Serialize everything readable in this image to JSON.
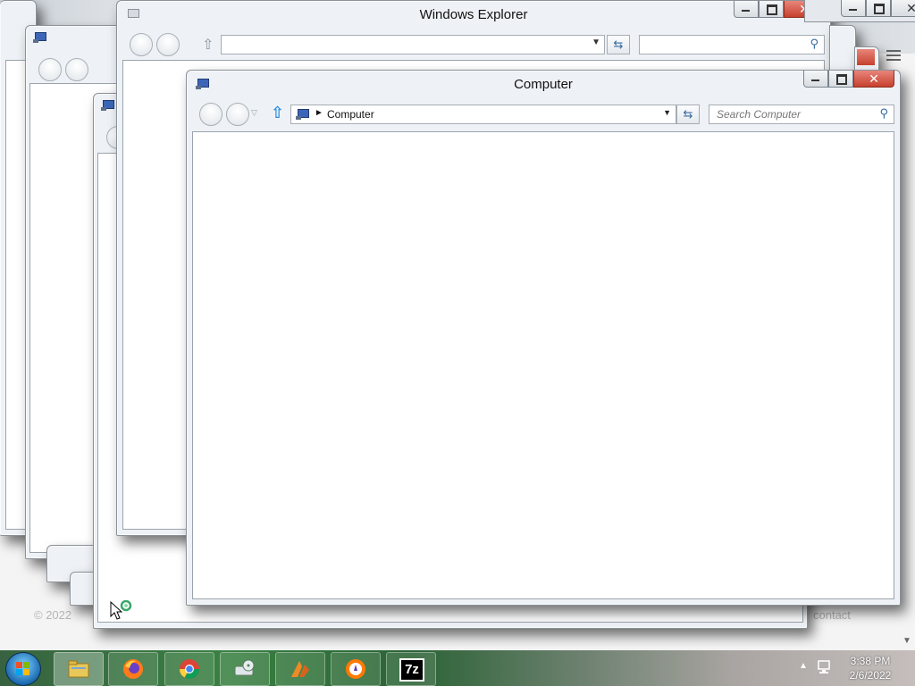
{
  "background_page": {
    "footer_left": "© 2022",
    "footer_right": "contact"
  },
  "windows": {
    "explorer_back": {
      "title": "Windows Explorer"
    },
    "computer": {
      "title": "Computer",
      "address": "Computer",
      "search_placeholder": "Search Computer"
    }
  },
  "taskbar": {
    "items": [
      {
        "name": "file-explorer",
        "icon": "folder-icon"
      },
      {
        "name": "firefox",
        "icon": "firefox-icon"
      },
      {
        "name": "chrome",
        "icon": "chrome-icon"
      },
      {
        "name": "disk-tool",
        "icon": "disk-icon"
      },
      {
        "name": "app-orange",
        "icon": "app-icon"
      },
      {
        "name": "avast-browser",
        "icon": "avast-icon"
      },
      {
        "name": "7zip",
        "icon": "7zip-icon",
        "label": "7z"
      }
    ],
    "clock_time": "3:38 PM",
    "clock_date": "2/6/2022"
  },
  "colors": {
    "accent": "#3d66b8",
    "close_red": "#c7402f"
  }
}
